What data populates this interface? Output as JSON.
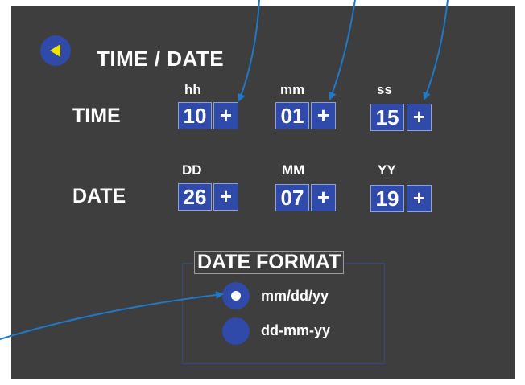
{
  "header": {
    "title": "TIME / DATE",
    "back_icon": "back-arrow-icon"
  },
  "time": {
    "label": "TIME",
    "fields": [
      {
        "unit": "hh",
        "value": "10",
        "plus": "+"
      },
      {
        "unit": "mm",
        "value": "01",
        "plus": "+"
      },
      {
        "unit": "ss",
        "value": "15",
        "plus": "+"
      }
    ]
  },
  "date": {
    "label": "DATE",
    "fields": [
      {
        "unit": "DD",
        "value": "26",
        "plus": "+"
      },
      {
        "unit": "MM",
        "value": "07",
        "plus": "+"
      },
      {
        "unit": "YY",
        "value": "19",
        "plus": "+"
      }
    ]
  },
  "date_format": {
    "title": "DATE FORMAT",
    "options": [
      {
        "label": "mm/dd/yy",
        "selected": true
      },
      {
        "label": "dd-mm-yy",
        "selected": false
      }
    ]
  },
  "colors": {
    "panel": "#3e3e3e",
    "accent": "#2f4aa8",
    "arrow": "#1f78c8",
    "back_arrow": "#f2e600"
  }
}
